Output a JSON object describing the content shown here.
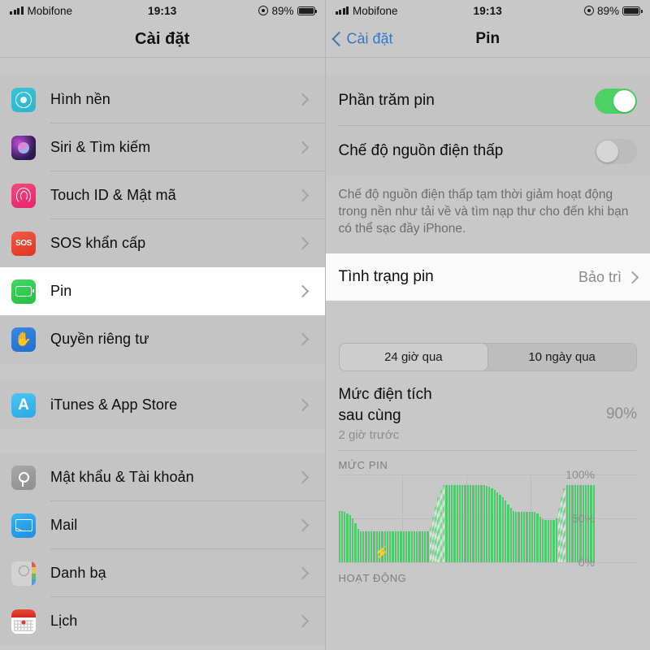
{
  "status_bar": {
    "carrier": "Mobifone",
    "time": "19:13",
    "battery_percent": "89%",
    "signal_icon": "signal-bars-icon",
    "location_icon": "location-services-icon",
    "battery_icon": "battery-icon"
  },
  "settings_pane": {
    "title": "Cài đặt",
    "groups": [
      {
        "items": [
          {
            "label": "Hình nền",
            "icon": "wallpaper-icon",
            "selected": false
          },
          {
            "label": "Siri & Tìm kiếm",
            "icon": "siri-icon",
            "selected": false
          },
          {
            "label": "Touch ID & Mật mã",
            "icon": "touch-id-icon",
            "selected": false
          },
          {
            "label": "SOS khẩn cấp",
            "icon": "sos-icon",
            "selected": false
          },
          {
            "label": "Pin",
            "icon": "battery-icon",
            "selected": true
          },
          {
            "label": "Quyền riêng tư",
            "icon": "privacy-hand-icon",
            "selected": false
          }
        ]
      },
      {
        "items": [
          {
            "label": "iTunes & App Store",
            "icon": "app-store-icon",
            "selected": false
          }
        ]
      },
      {
        "items": [
          {
            "label": "Mật khẩu & Tài khoản",
            "icon": "key-icon",
            "selected": false
          },
          {
            "label": "Mail",
            "icon": "mail-icon",
            "selected": false
          },
          {
            "label": "Danh bạ",
            "icon": "contacts-icon",
            "selected": false
          },
          {
            "label": "Lịch",
            "icon": "calendar-icon",
            "selected": false
          }
        ]
      }
    ],
    "chevron_icon": "chevron-right-icon"
  },
  "battery_pane": {
    "back_label": "Cài đặt",
    "back_icon": "chevron-left-icon",
    "title": "Pin",
    "rows": {
      "battery_percentage": {
        "label": "Phần trăm pin",
        "state": "on"
      },
      "low_power_mode": {
        "label": "Chế độ nguồn điện thấp",
        "state": "off"
      },
      "battery_health": {
        "label": "Tình trạng pin",
        "value": "Bảo trì"
      }
    },
    "footnote": "Chế độ nguồn điện thấp tạm thời giảm hoạt động trong nền như tải về và tìm nạp thư cho đến khi bạn có thể sạc đầy iPhone.",
    "segments": [
      {
        "label": "24 giờ qua",
        "active": true
      },
      {
        "label": "10 ngày qua",
        "active": false
      }
    ],
    "last_level": {
      "title_line1": "Mức điện tích",
      "title_line2": "sau cùng",
      "subtitle": "2 giờ trước",
      "percent": "90%"
    },
    "activity_header": "HOẠT ĐỘNG"
  },
  "colors": {
    "accent_green": "#4fc96b",
    "toggle_on": "#4cd264",
    "link_blue": "#3478c6",
    "pane_background": "#c8c8c8",
    "card_background": "#c4c4c4",
    "selected_row": "#ffffff"
  },
  "chart_data": {
    "type": "bar",
    "title": "MỨC PIN",
    "ylabel": "",
    "xlabel": "",
    "ylim": [
      0,
      100
    ],
    "ytick_labels": [
      "100%",
      "50%",
      "0%"
    ],
    "ytick_values": [
      100,
      50,
      0
    ],
    "grid": true,
    "legend": null,
    "annotations": [
      "charging-bolt-icon"
    ],
    "series": [
      {
        "name": "Mức pin",
        "values": [
          58,
          58,
          57,
          56,
          54,
          50,
          44,
          38,
          35,
          35,
          35,
          35,
          35,
          35,
          35,
          35,
          35,
          35,
          35,
          35,
          35,
          35,
          35,
          35,
          35,
          35,
          35,
          35,
          35,
          35,
          35,
          35,
          35,
          35,
          40,
          52,
          64,
          74,
          82,
          88,
          88,
          88,
          88,
          88,
          88,
          88,
          88,
          88,
          88,
          88,
          88,
          88,
          88,
          88,
          88,
          87,
          86,
          84,
          82,
          80,
          77,
          74,
          70,
          66,
          62,
          58,
          57,
          57,
          57,
          57,
          57,
          57,
          57,
          57,
          56,
          52,
          49,
          48,
          48,
          48,
          48,
          50,
          62,
          74,
          84,
          88,
          88,
          88,
          88,
          88,
          88,
          88,
          88,
          88,
          88,
          88
        ],
        "charging_flags": [
          false,
          false,
          false,
          false,
          false,
          false,
          false,
          false,
          false,
          false,
          false,
          false,
          false,
          false,
          false,
          false,
          false,
          false,
          false,
          false,
          false,
          false,
          false,
          false,
          false,
          false,
          false,
          false,
          false,
          false,
          false,
          false,
          false,
          false,
          true,
          true,
          true,
          true,
          true,
          true,
          false,
          false,
          false,
          false,
          false,
          false,
          false,
          false,
          false,
          false,
          false,
          false,
          false,
          false,
          false,
          false,
          false,
          false,
          false,
          false,
          false,
          false,
          false,
          false,
          false,
          false,
          false,
          false,
          false,
          false,
          false,
          false,
          false,
          false,
          false,
          false,
          false,
          false,
          false,
          false,
          false,
          false,
          true,
          true,
          true,
          false,
          false,
          false,
          false,
          false,
          false,
          false,
          false,
          false,
          false,
          false
        ]
      }
    ]
  }
}
